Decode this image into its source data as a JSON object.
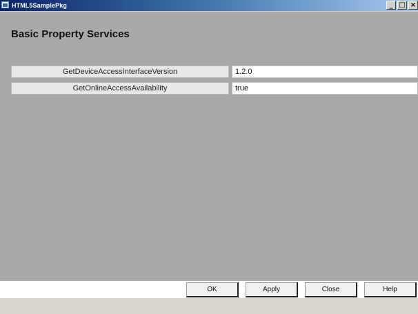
{
  "window": {
    "title": "HTML5SamplePkg",
    "controls": {
      "minimize": "_",
      "maximize": "□",
      "close": "×"
    }
  },
  "main": {
    "heading": "Basic Property Services",
    "properties": [
      {
        "label": "GetDeviceAccessInterfaceVersion",
        "value": "1.2.0"
      },
      {
        "label": "GetOnlineAccessAvailability",
        "value": "true"
      }
    ]
  },
  "footer": {
    "ok_label": "OK",
    "apply_label": "Apply",
    "close_label": "Close",
    "help_label": "Help"
  },
  "colors": {
    "content_bg": "#a9a9a9",
    "title_bar_start": "#0a246a",
    "title_bar_end": "#a6caf0"
  }
}
